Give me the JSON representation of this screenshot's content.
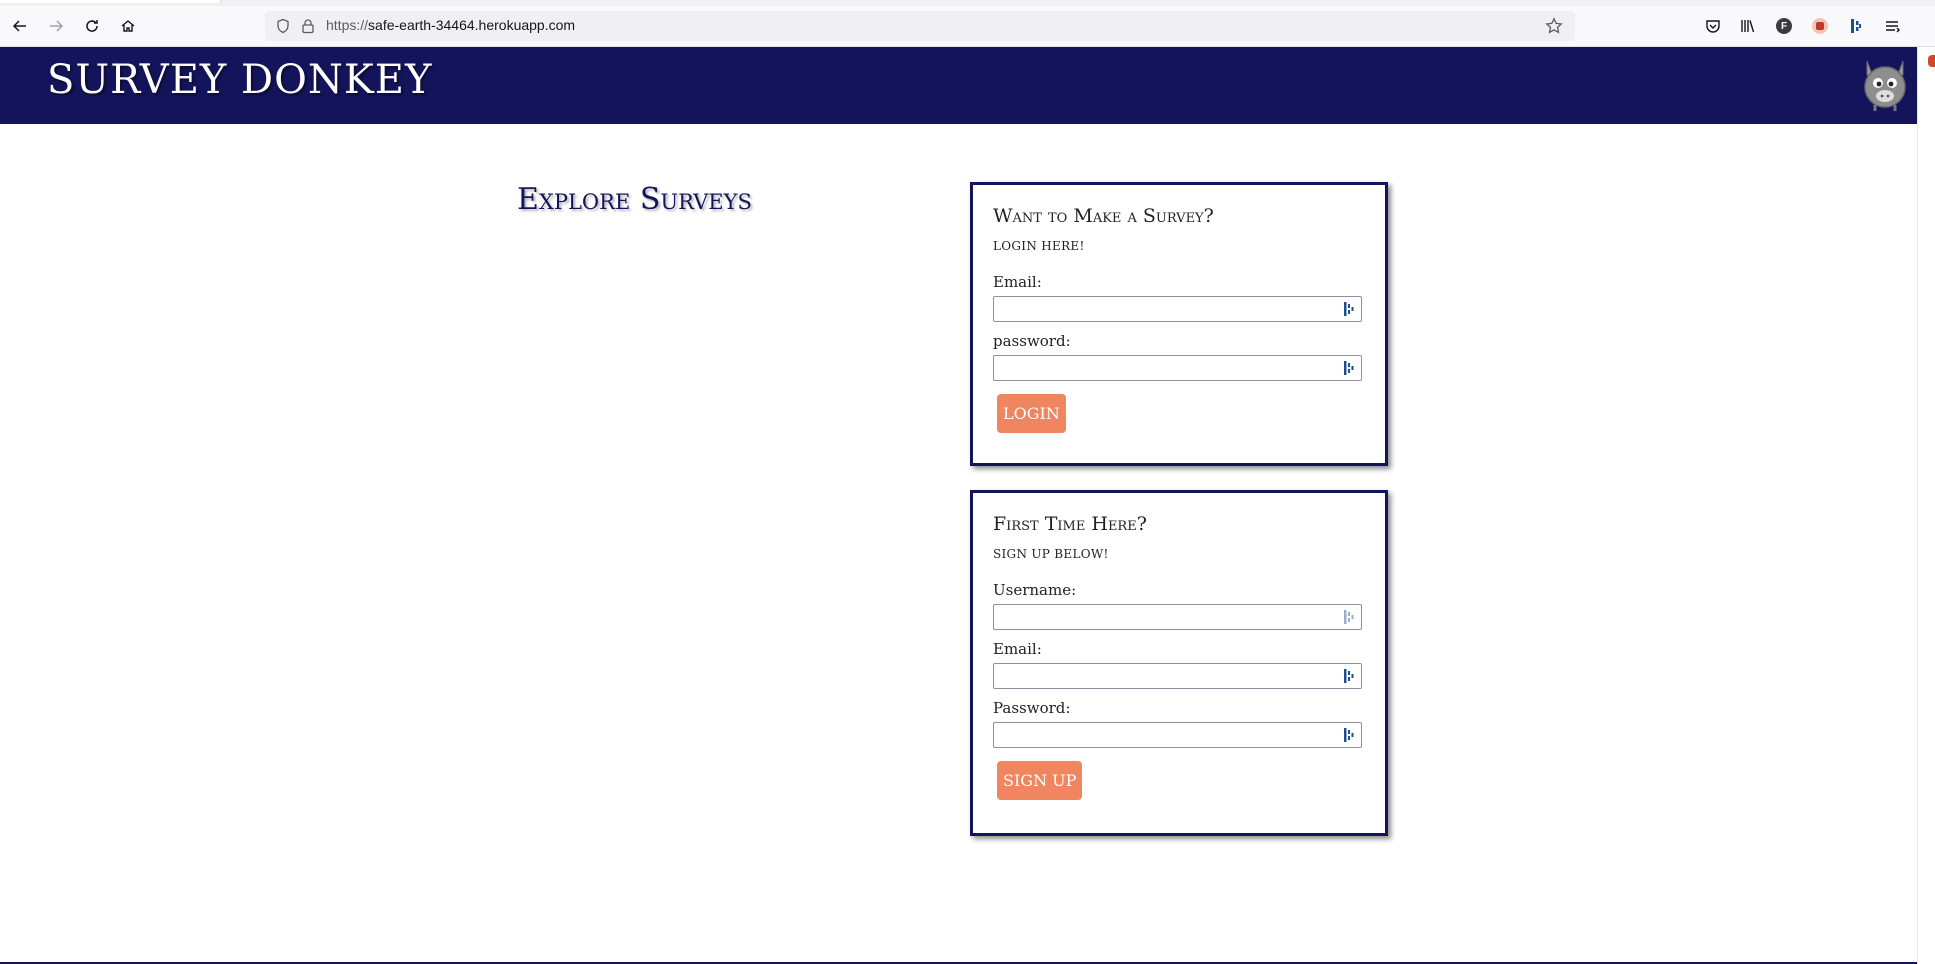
{
  "browser": {
    "url_scheme": "https://",
    "url_host": "safe-earth-34464.herokuapp.com",
    "extension_f_letter": "F"
  },
  "site": {
    "title": "SURVEY DONKEY"
  },
  "main": {
    "explore_heading": "Explore Surveys"
  },
  "login_card": {
    "title": "Want to Make a Survey?",
    "subtitle": "login here!",
    "email_label": "Email:",
    "email_value": "",
    "password_label": "password:",
    "password_value": "",
    "button_label": "LOGIN"
  },
  "signup_card": {
    "title": "First Time Here?",
    "subtitle": "sign up below!",
    "username_label": "Username:",
    "username_value": "",
    "email_label": "Email:",
    "email_value": "",
    "password_label": "Password:",
    "password_value": "",
    "button_label": "SIGN UP"
  },
  "colors": {
    "header_bg": "#14145c",
    "button_bg": "#ef8660",
    "card_border": "#14145c"
  },
  "icons": {
    "browser": [
      "back-icon",
      "forward-icon",
      "reload-icon",
      "home-icon",
      "shield-icon",
      "lock-icon",
      "bookmark-star-icon",
      "pocket-icon",
      "library-icon",
      "extension-f-icon",
      "extension-h-icon",
      "password-manager-icon",
      "menu-icon"
    ],
    "site": [
      "donkey-avatar-icon",
      "password-manager-field-icon"
    ]
  }
}
